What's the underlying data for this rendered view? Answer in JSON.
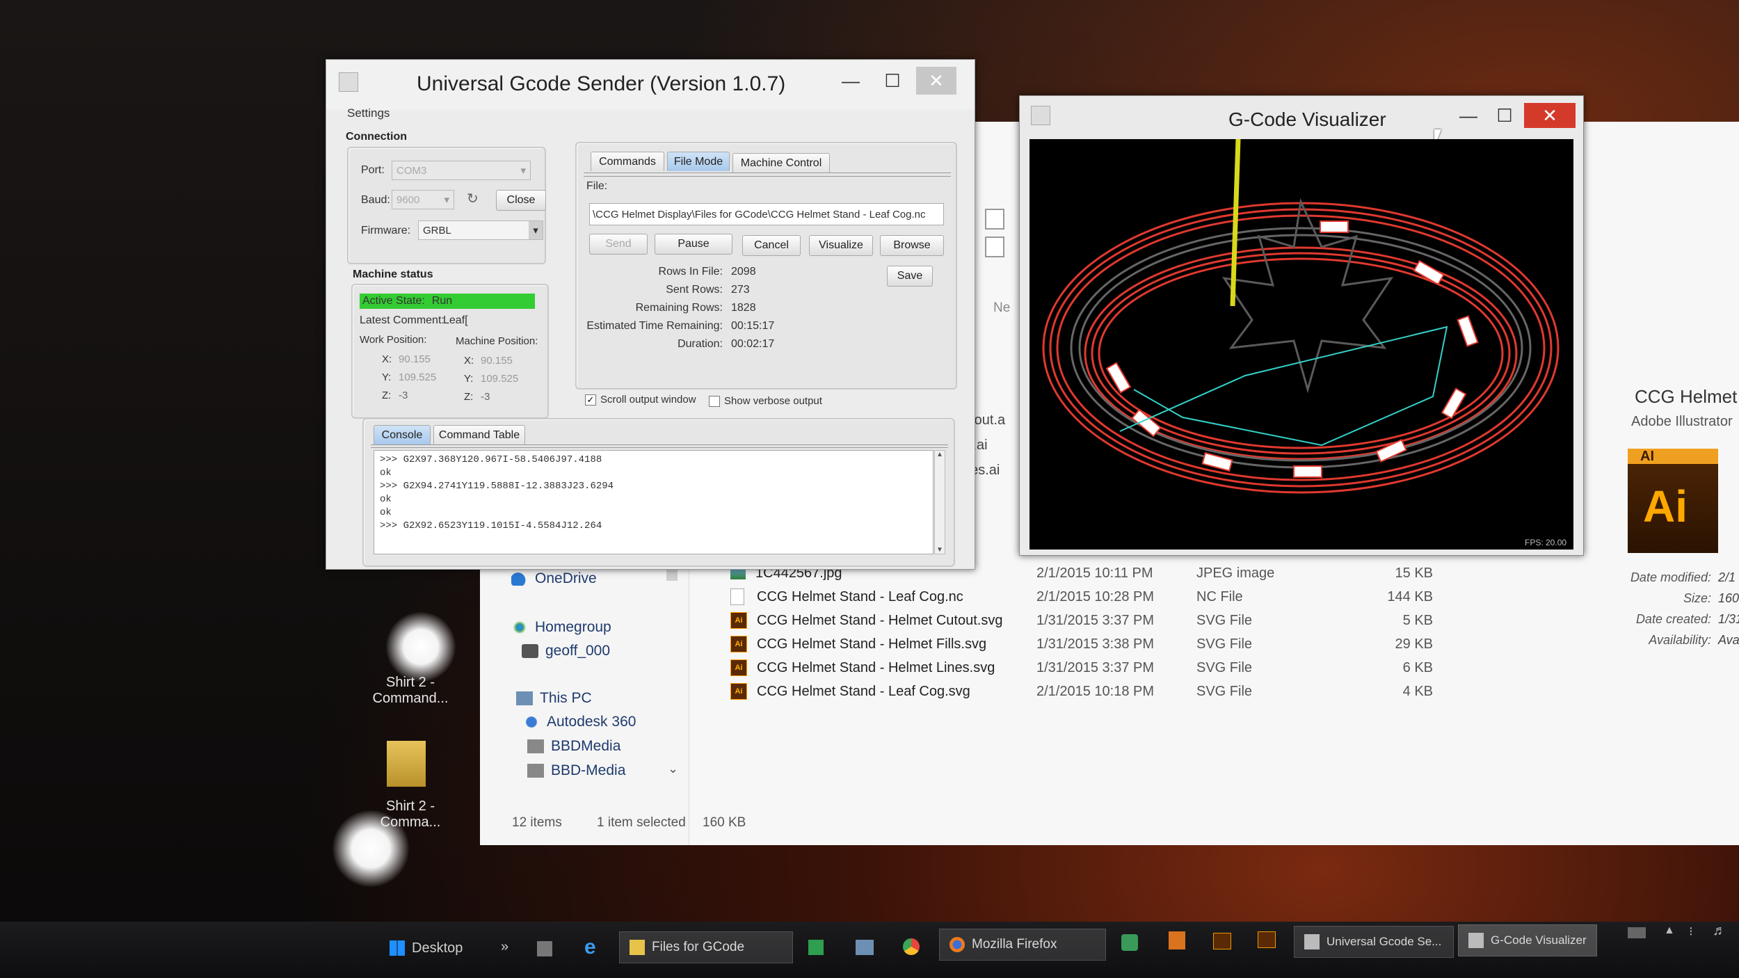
{
  "ugs": {
    "title": "Universal Gcode Sender (Version 1.0.7)",
    "menu_settings": "Settings",
    "connection": {
      "header": "Connection",
      "port_label": "Port:",
      "port_value": "COM3",
      "baud_label": "Baud:",
      "baud_value": "9600",
      "close_label": "Close",
      "firmware_label": "Firmware:",
      "firmware_value": "GRBL"
    },
    "machine_status": {
      "header": "Machine status",
      "active_state_label": "Active State:",
      "active_state_value": "Run",
      "latest_comment_label": "Latest Comment:",
      "latest_comment_value": "Leaf[",
      "work_position_label": "Work Position:",
      "machine_position_label": "Machine Position:",
      "work_x_label": "X:",
      "work_x": "90.155",
      "work_y_label": "Y:",
      "work_y": "109.525",
      "work_z_label": "Z:",
      "work_z": "-3",
      "mach_x_label": "X:",
      "mach_x": "90.155",
      "mach_y_label": "Y:",
      "mach_y": "109.525",
      "mach_z_label": "Z:",
      "mach_z": "-3"
    },
    "tabs": [
      "Commands",
      "File Mode",
      "Machine Control"
    ],
    "file_label": "File:",
    "file_path": "\\CCG Helmet Display\\Files for GCode\\CCG Helmet Stand - Leaf Cog.nc",
    "buttons": {
      "send": "Send",
      "pause": "Pause",
      "cancel": "Cancel",
      "visualize": "Visualize",
      "browse": "Browse",
      "save": "Save"
    },
    "stats": {
      "rows_in_file_label": "Rows In File:",
      "rows_in_file": "2098",
      "sent_rows_label": "Sent Rows:",
      "sent_rows": "273",
      "remaining_rows_label": "Remaining Rows:",
      "remaining_rows": "1828",
      "est_time_label": "Estimated Time Remaining:",
      "est_time": "00:15:17",
      "duration_label": "Duration:",
      "duration": "00:02:17"
    },
    "scroll_output": "Scroll output window",
    "verbose_output": "Show verbose output",
    "console_tabs": [
      "Console",
      "Command Table"
    ],
    "console_lines": [
      ">>> G2X97.368Y120.967I-58.5406J97.4188",
      "ok",
      ">>> G2X94.2741Y119.5888I-12.3883J23.6294",
      "ok",
      "ok",
      ">>> G2X92.6523Y119.1015I-4.5584J12.264"
    ]
  },
  "visualizer": {
    "title": "G-Code Visualizer",
    "fps": "FPS: 20.00"
  },
  "explorer": {
    "partial_names": [
      "utout.a",
      "ls.ai",
      "nes.ai",
      "ai"
    ],
    "partial_col": "Ne",
    "nav": {
      "onedrive": "OneDrive",
      "homegroup": "Homegroup",
      "user": "geoff_000",
      "thispc": "This PC",
      "autodesk": "Autodesk 360",
      "bbdmedia1": "BBDMedia",
      "bbdmedia2": "BBD-Media"
    },
    "files": [
      {
        "name": "1C442567.jpg",
        "date": "2/1/2015 10:11 PM",
        "type": "JPEG image",
        "size": "15 KB",
        "icon": "image-icon"
      },
      {
        "name": "CCG Helmet Stand - Leaf Cog.nc",
        "date": "2/1/2015 10:28 PM",
        "type": "NC File",
        "size": "144 KB",
        "icon": "doc-icon"
      },
      {
        "name": "CCG Helmet Stand - Helmet Cutout.svg",
        "date": "1/31/2015 3:37 PM",
        "type": "SVG File",
        "size": "5 KB",
        "icon": "ai-icon"
      },
      {
        "name": "CCG Helmet Stand - Helmet Fills.svg",
        "date": "1/31/2015 3:38 PM",
        "type": "SVG File",
        "size": "29 KB",
        "icon": "ai-icon"
      },
      {
        "name": "CCG Helmet Stand - Helmet Lines.svg",
        "date": "1/31/2015 3:37 PM",
        "type": "SVG File",
        "size": "6 KB",
        "icon": "ai-icon"
      },
      {
        "name": "CCG Helmet Stand - Leaf Cog.svg",
        "date": "2/1/2015 10:18 PM",
        "type": "SVG File",
        "size": "4 KB",
        "icon": "ai-icon"
      }
    ],
    "status": {
      "items": "12 items",
      "selected": "1 item selected",
      "size": "160 KB"
    },
    "details": {
      "title": "CCG Helmet",
      "app": "Adobe Illustrator",
      "ai_big_top": "AI",
      "ai_big": "Ai",
      "date_modified_label": "Date modified:",
      "date_modified": "2/1",
      "size_label": "Size:",
      "size": "160",
      "date_created_label": "Date created:",
      "date_created": "1/31",
      "availability_label": "Availability:",
      "availability": "Avail"
    }
  },
  "desktop": {
    "icon1": "Shirt 2 -\nCommand...",
    "icon2": "Shirt 2 -\nComma..."
  },
  "taskbar": {
    "desktop": "Desktop",
    "chevrons": "»",
    "files_for_gcode": "Files for GCode",
    "firefox": "Mozilla Firefox",
    "ugs": "Universal Gcode Se...",
    "visualizer": "G-Code Visualizer"
  },
  "colors": {
    "active_state_bg": "#33cc33",
    "toolpath_red": "#e0392f",
    "tool_yellow": "#d9d91a",
    "rapid_cyan": "#33d1c8"
  }
}
